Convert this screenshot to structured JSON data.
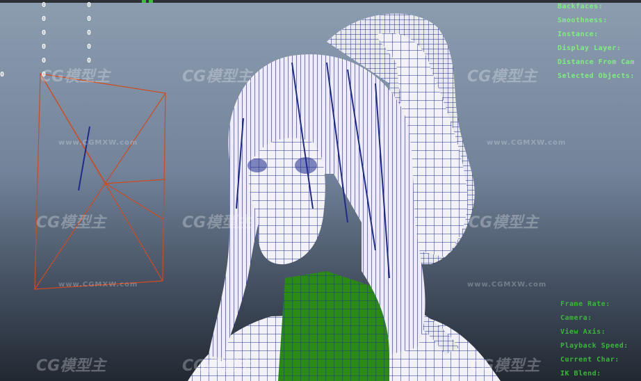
{
  "hud_left": {
    "rows": [
      [
        "",
        "0",
        "0"
      ],
      [
        "",
        "0",
        "0"
      ],
      [
        "",
        "0",
        "0"
      ],
      [
        "",
        "0",
        "0"
      ],
      [
        "",
        "0",
        "0"
      ],
      [
        "0",
        "0",
        ""
      ]
    ]
  },
  "hud_right": {
    "lines": [
      "Backfaces:",
      "Smoothness:",
      "Instance:",
      "Display Layer:",
      "Distance From Cam",
      "Selected Objects:"
    ]
  },
  "hud_right_bottom": {
    "lines": [
      "Frame Rate:",
      "Camera:",
      "View Axis:",
      "Playback Speed:",
      "Current Char:",
      "IK Blend:"
    ]
  },
  "watermark": {
    "logo": "CG模型主",
    "url": "www.CGMXW.com"
  },
  "colors": {
    "wire": "#1e2a8c",
    "mesh_fill": "#f2f2f6",
    "neck_fill": "#2a8a14",
    "camera_lines": "#d04a20"
  }
}
